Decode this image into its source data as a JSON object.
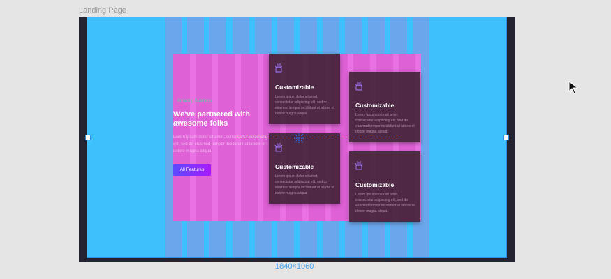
{
  "canvas": {
    "frame_label": "Landing Page",
    "dimensions_label": "1840×1060",
    "colors": {
      "frame_fill": "#3ec0fc",
      "section_fill": "#ea71e3",
      "selection": "#2a8fe0",
      "column_overlay": "#a982d7"
    }
  },
  "hero": {
    "eyebrow": "Amazing Business",
    "heading": "We've partnered with awesome folks",
    "body": "Lorem ipsum dolor sit amet, consectetur adipiscing elit, sed do eiusmod tempor incididunt ut labore et dolore magna aliqua.",
    "cta_label": "All Features"
  },
  "cards": [
    {
      "icon": "brush-cup-icon",
      "title": "Customizable",
      "text": "Lorem ipsum dolor sit amet, consectetur adipiscing elit, sed do eiusmod tempor incididunt ut labore et dolore magna aliqua."
    },
    {
      "icon": "brush-cup-icon",
      "title": "Customizable",
      "text": "Lorem ipsum dolor sit amet, consectetur adipiscing elit, sed do eiusmod tempor incididunt ut labore et dolore magna aliqua."
    },
    {
      "icon": "brush-cup-icon",
      "title": "Customizable",
      "text": "Lorem ipsum dolor sit amet, consectetur adipiscing elit, sed do eiusmod tempor incididunt ut labore et dolore magna aliqua."
    },
    {
      "icon": "brush-cup-icon",
      "title": "Customizable",
      "text": "Lorem ipsum dolor sit amet, consectetur adipiscing elit, sed do eiusmod tempor incididunt ut labore et dolore magna aliqua."
    }
  ]
}
